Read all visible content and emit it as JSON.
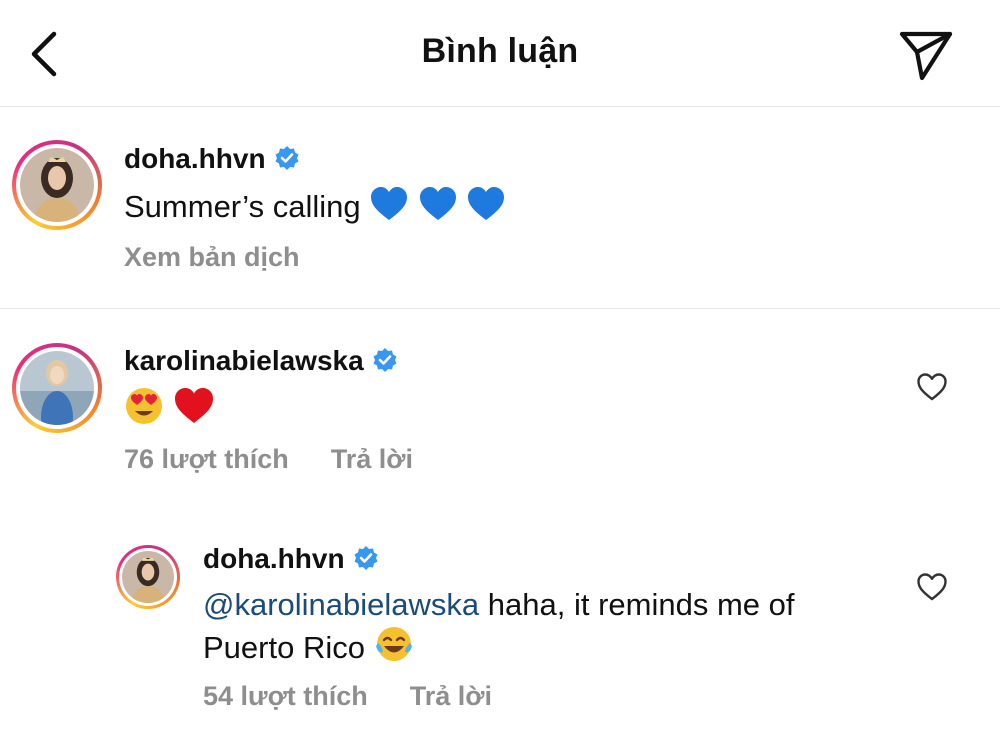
{
  "header": {
    "title": "Bình luận",
    "back_icon": "chevron-left-icon",
    "send_icon": "paper-plane-icon"
  },
  "caption": {
    "username": "doha.hhvn",
    "text": "Summer’s calling",
    "emojis": [
      "blue-heart",
      "blue-heart",
      "blue-heart"
    ],
    "translate_label": "Xem bản dịch"
  },
  "comments": [
    {
      "username": "karolinabielawska",
      "emojis": [
        "heart-eyes",
        "red-heart"
      ],
      "likes_label": "76 lượt thích",
      "reply_label": "Trả lời"
    },
    {
      "username": "doha.hhvn",
      "mention": "@karolinabielawska",
      "text_line1": " haha, it reminds me of",
      "text_line2": "Puerto Rico",
      "emojis": [
        "tears-of-joy"
      ],
      "likes_label": "54 lượt thích",
      "reply_label": "Trả lời"
    }
  ],
  "colors": {
    "verified": "#3897f0",
    "mention": "#1a4b7a",
    "meta": "#8e8e8e",
    "divider": "#e6e6e6"
  }
}
